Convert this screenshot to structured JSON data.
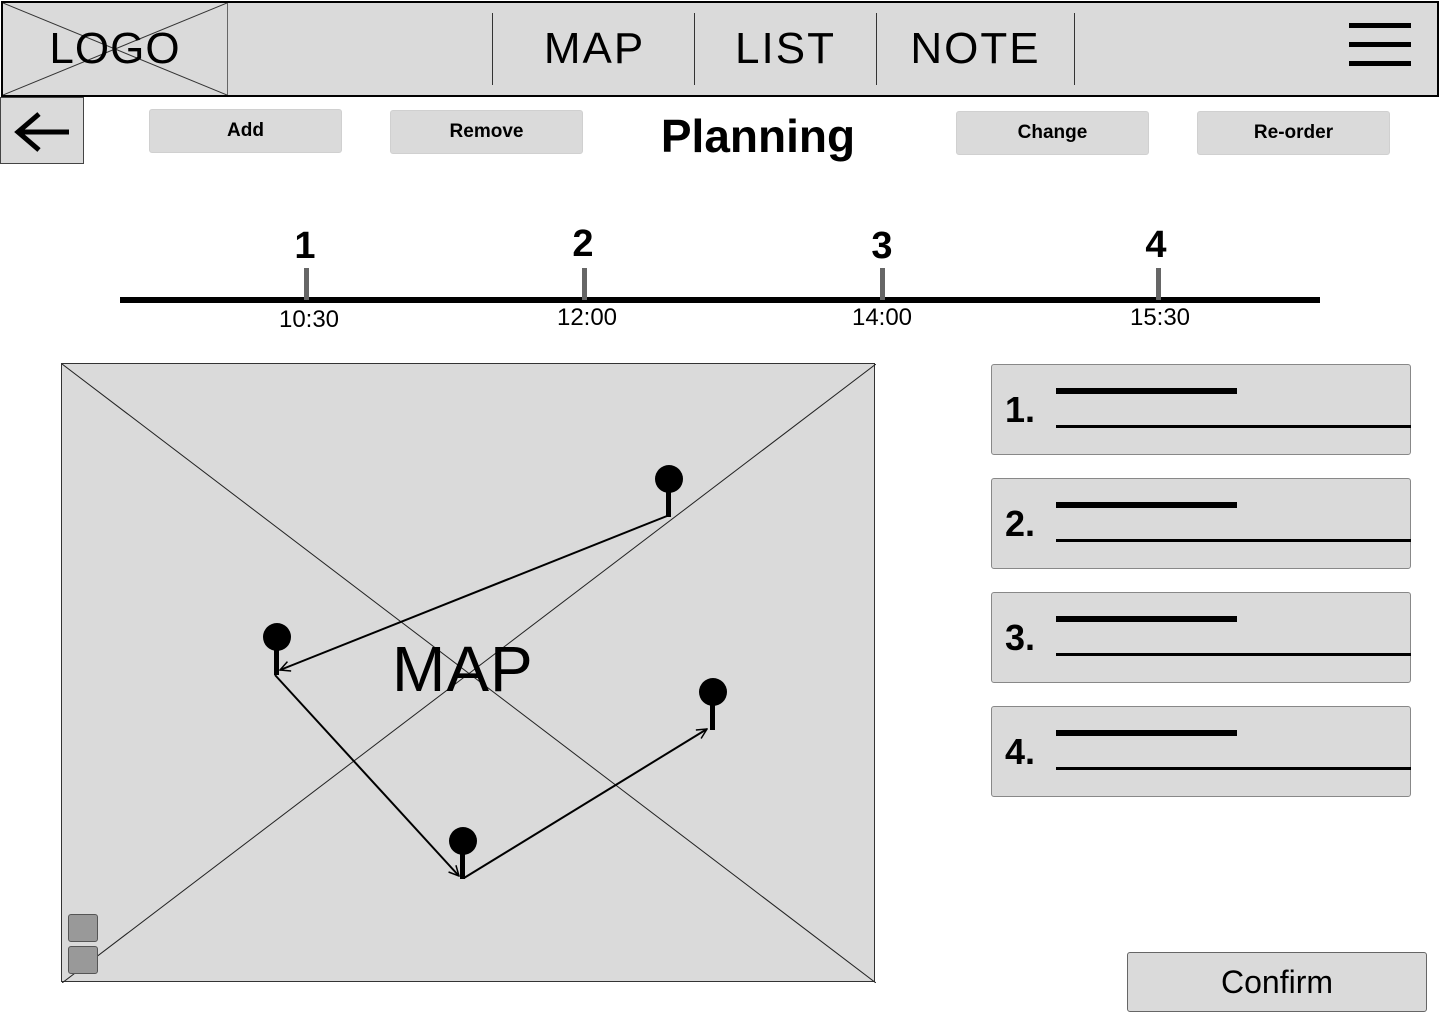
{
  "header": {
    "logo": "LOGO",
    "nav": [
      "MAP",
      "LIST",
      "NOTE"
    ],
    "menu_icon": "hamburger-menu-icon"
  },
  "toolbar": {
    "back_icon": "arrow-left-icon",
    "add_label": "Add",
    "remove_label": "Remove",
    "title": "Planning",
    "change_label": "Change",
    "reorder_label": "Re-order"
  },
  "timeline": {
    "stops": [
      {
        "number": "1",
        "time": "10:30"
      },
      {
        "number": "2",
        "time": "12:00"
      },
      {
        "number": "3",
        "time": "14:00"
      },
      {
        "number": "4",
        "time": "15:30"
      }
    ]
  },
  "map": {
    "label": "MAP",
    "pin_icon": "map-pin-icon",
    "zoom_icons": [
      "zoom-in-icon",
      "zoom-out-icon"
    ]
  },
  "stop_list": {
    "items": [
      {
        "label": "1."
      },
      {
        "label": "2."
      },
      {
        "label": "3."
      },
      {
        "label": "4."
      }
    ]
  },
  "confirm_label": "Confirm"
}
